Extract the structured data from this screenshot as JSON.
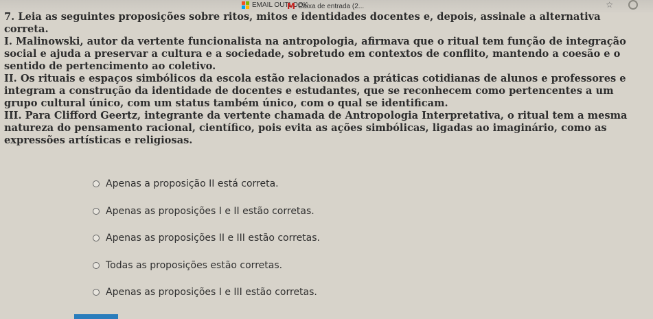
{
  "browser": {
    "bookmarks": [
      {
        "label": "EMAIL OUTLOOK",
        "icon": "microsoft-icon"
      },
      {
        "label": "Caixa de entrada (2...",
        "icon": "gmail-icon"
      }
    ],
    "star_icon": "star-icon",
    "profile_icon": "profile-icon",
    "colors": {
      "ms_red": "#f25022",
      "ms_green": "#7fba00",
      "ms_blue": "#00a4ef",
      "ms_yellow": "#ffb900",
      "gmail_red": "#c5221f"
    }
  },
  "question": {
    "statement": "7. Leia as seguintes proposições sobre ritos, mitos e identidades docentes e, depois, assinale a alternativa correta.",
    "propositions": [
      "I. Malinowski, autor da vertente funcionalista na antropologia, afirmava que o ritual tem função de integração social e ajuda a preservar a cultura e a sociedade, sobretudo em contextos de conflito, mantendo a coesão e o sentido de pertencimento ao coletivo.",
      "II. Os rituais e espaços simbólicos da escola estão relacionados a práticas cotidianas de alunos e professores e integram a construção da identidade de docentes e estudantes, que se reconhecem como pertencentes a um grupo cultural único, com um status também único, com o qual se identificam.",
      "III. Para Clifford Geertz, integrante da vertente chamada de Antropologia Interpretativa, o ritual tem a mesma natureza do pensamento racional, científico, pois evita as ações simbólicas, ligadas ao imaginário, como as expressões artísticas e religiosas."
    ]
  },
  "options": [
    "Apenas a proposição II está correta.",
    "Apenas as proposições I e II estão corretas.",
    "Apenas as proposições II e III estão corretas.",
    "Todas as proposições estão corretas.",
    "Apenas as proposições I e III estão corretas."
  ],
  "accent_color": "#2a7dbc"
}
